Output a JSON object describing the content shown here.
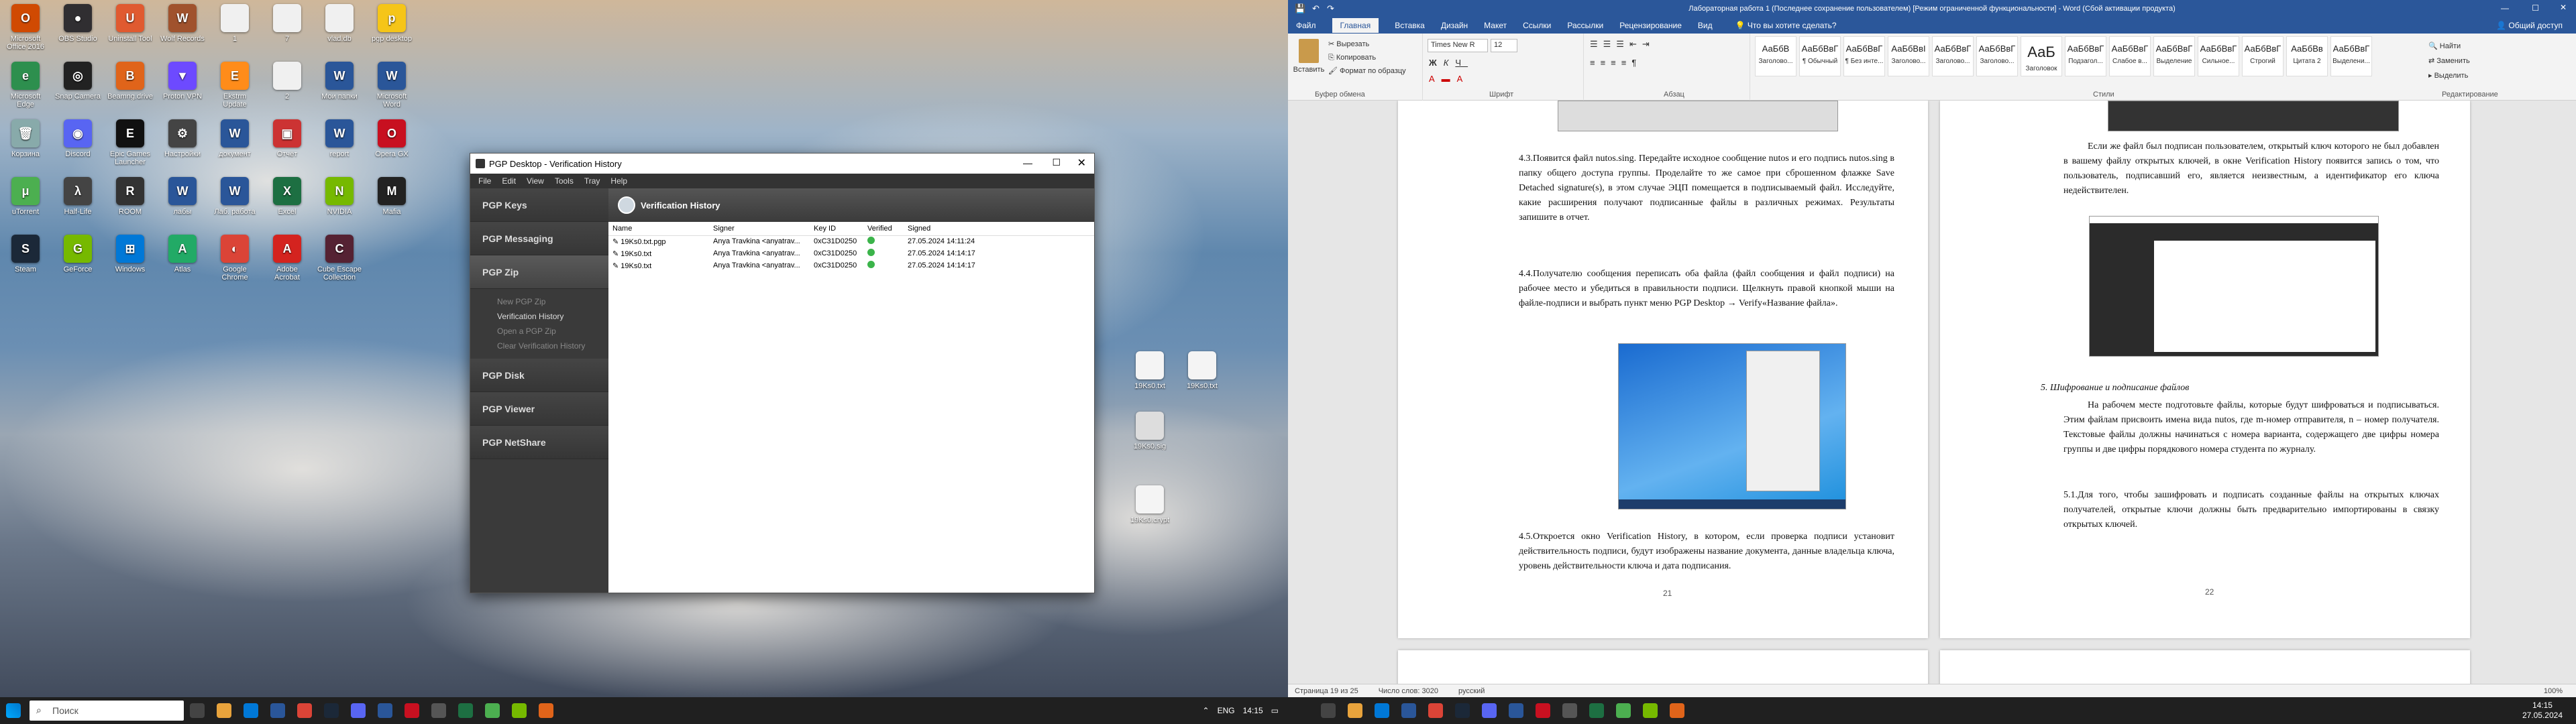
{
  "desktop": {
    "icons": [
      {
        "label": "Microsoft Office 2016",
        "color": "#d04a02",
        "g": "O"
      },
      {
        "label": "OBS Studio",
        "color": "#302e31",
        "g": "●"
      },
      {
        "label": "Uninstall Tool",
        "color": "#e05a30",
        "g": "U"
      },
      {
        "label": "Wolf Records",
        "color": "#a0522d",
        "g": "W"
      },
      {
        "label": "1",
        "color": "#f0f0f0",
        "g": ""
      },
      {
        "label": "7",
        "color": "#f0f0f0",
        "g": ""
      },
      {
        "label": "vlad.db",
        "color": "#f0f0f0",
        "g": ""
      },
      {
        "label": "pgp desktop",
        "color": "#f5c518",
        "g": "p"
      },
      {
        "label": "Microsoft Edge",
        "color": "#2d8f4e",
        "g": "e"
      },
      {
        "label": "Snap Camera",
        "color": "#222",
        "g": "◎"
      },
      {
        "label": "Beamng.drive",
        "color": "#e0641a",
        "g": "B"
      },
      {
        "label": "Proton VPN",
        "color": "#6d4aff",
        "g": "▼"
      },
      {
        "label": "Ekstrm Update",
        "color": "#ff8c1a",
        "g": "E"
      },
      {
        "label": "2",
        "color": "#f0f0f0",
        "g": ""
      },
      {
        "label": "Мои папки",
        "color": "#2a5699",
        "g": "W"
      },
      {
        "label": "Microsoft Word",
        "color": "#2a5699",
        "g": "W"
      },
      {
        "label": "Корзина",
        "color": "#8aa",
        "g": "🗑"
      },
      {
        "label": "Discord",
        "color": "#5865f2",
        "g": "◉"
      },
      {
        "label": "Epic Games Launcher",
        "color": "#111",
        "g": "E"
      },
      {
        "label": "Настройки",
        "color": "#444",
        "g": "⚙"
      },
      {
        "label": "документ",
        "color": "#2a5699",
        "g": "W"
      },
      {
        "label": "Отчёт",
        "color": "#c33",
        "g": "▣"
      },
      {
        "label": "report",
        "color": "#2a5699",
        "g": "W"
      },
      {
        "label": "Opera GX",
        "color": "#c81020",
        "g": "O"
      },
      {
        "label": "uTorrent",
        "color": "#4caf50",
        "g": "μ"
      },
      {
        "label": "Half-Life",
        "color": "#444",
        "g": "λ"
      },
      {
        "label": "ROOM",
        "color": "#333",
        "g": "R"
      },
      {
        "label": "лабы",
        "color": "#2a5699",
        "g": "W"
      },
      {
        "label": "Лаб. работа",
        "color": "#2a5699",
        "g": "W"
      },
      {
        "label": "Excel",
        "color": "#1d6f42",
        "g": "X"
      },
      {
        "label": "NVIDIA",
        "color": "#76b900",
        "g": "N"
      },
      {
        "label": "Mafia",
        "color": "#222",
        "g": "M"
      },
      {
        "label": "Steam",
        "color": "#1b2838",
        "g": "S"
      },
      {
        "label": "GeForce",
        "color": "#76b900",
        "g": "G"
      },
      {
        "label": "Windows",
        "color": "#0078d7",
        "g": "⊞"
      },
      {
        "label": "Atlas",
        "color": "#2a6",
        "g": "A"
      },
      {
        "label": "Google Chrome",
        "color": "#db4437",
        "g": "◐"
      },
      {
        "label": "Adobe Acrobat",
        "color": "#d4231f",
        "g": "A"
      },
      {
        "label": "Cube Escape Collection",
        "color": "#552233",
        "g": "C"
      }
    ],
    "files_right": [
      {
        "label": "19Ks0.txt"
      },
      {
        "label": "19Ks0.txt"
      },
      {
        "label": "19Ks0.sig"
      },
      {
        "label": "19Ks0.crypt"
      }
    ]
  },
  "pgp": {
    "title": "PGP Desktop - Verification History",
    "menu": [
      "File",
      "Edit",
      "View",
      "Tools",
      "Tray",
      "Help"
    ],
    "sections": [
      {
        "label": "PGP Keys"
      },
      {
        "label": "PGP Messaging"
      },
      {
        "label": "PGP Zip"
      },
      {
        "label": "PGP Disk"
      },
      {
        "label": "PGP Viewer"
      },
      {
        "label": "PGP NetShare"
      }
    ],
    "zip_items": [
      {
        "label": "New PGP Zip",
        "dim": true
      },
      {
        "label": "Verification History",
        "dim": false
      },
      {
        "label": "Open a PGP Zip",
        "dim": true
      },
      {
        "label": "Clear Verification History",
        "dim": true
      }
    ],
    "panel_title": "Verification History",
    "columns": [
      "Name",
      "Signer",
      "Key ID",
      "Verified",
      "Signed"
    ],
    "rows": [
      {
        "name": "19Ks0.txt.pgp",
        "signer": "Anya Travkina <anyatrav...",
        "key": "0xC31D0250",
        "signed": "27.05.2024 14:11:24"
      },
      {
        "name": "19Ks0.txt",
        "signer": "Anya Travkina <anyatrav...",
        "key": "0xC31D0250",
        "signed": "27.05.2024 14:14:17"
      },
      {
        "name": "19Ks0.txt",
        "signer": "Anya Travkina <anyatrav...",
        "key": "0xC31D0250",
        "signed": "27.05.2024 14:14:17"
      }
    ]
  },
  "taskbar_left": {
    "search_placeholder": "Поиск",
    "time": "14:15",
    "lang": "ENG"
  },
  "word": {
    "title": "Лабораторная работа 1 (Последнее сохранение пользователем) [Режим ограниченной функциональности] - Word (Сбой активации продукта)",
    "tabs": [
      "Файл",
      "Главная",
      "Вставка",
      "Дизайн",
      "Макет",
      "Ссылки",
      "Рассылки",
      "Рецензирование",
      "Вид"
    ],
    "tell_me": "Что вы хотите сделать?",
    "share": "Общий доступ",
    "clipboard": {
      "paste": "Вставить",
      "cut": "Вырезать",
      "copy": "Копировать",
      "format": "Формат по образцу",
      "label": "Буфер обмена"
    },
    "font": {
      "name": "Times New R",
      "size": "12",
      "label": "Шрифт"
    },
    "paragraph_label": "Абзац",
    "styles_label": "Стили",
    "editing": {
      "find": "Найти",
      "replace": "Заменить",
      "select": "Выделить",
      "label": "Редактирование"
    },
    "styles": [
      {
        "sample": "АаБбВ",
        "name": "Заголово..."
      },
      {
        "sample": "АаБбВвГ",
        "name": "¶ Обычный"
      },
      {
        "sample": "АаБбВвГ",
        "name": "¶ Без инте..."
      },
      {
        "sample": "АаБбВвI",
        "name": "Заголово..."
      },
      {
        "sample": "АаБбВвГ",
        "name": "Заголово..."
      },
      {
        "sample": "АаБбВвГ",
        "name": "Заголово..."
      },
      {
        "sample": "АаБ",
        "name": "Заголовок"
      },
      {
        "sample": "АаБбВвГ",
        "name": "Подзагол..."
      },
      {
        "sample": "АаБбВвГ",
        "name": "Слабое в..."
      },
      {
        "sample": "АаБбВвГ",
        "name": "Выделение"
      },
      {
        "sample": "АаБбВвГ",
        "name": "Сильное..."
      },
      {
        "sample": "АаБбВвГ",
        "name": "Строгий"
      },
      {
        "sample": "АаБбВв",
        "name": "Цитата 2"
      },
      {
        "sample": "АаБбВвГ",
        "name": "Выделени..."
      }
    ],
    "page_left": {
      "p43": "4.3.Появится файл nutos.sing. Передайте исходное сообщение nutos и его подпись nutos.sing в папку общего доступа группы. Проделайте то же самое при сброшенном флажке Save Detached signature(s), в этом случае ЭЦП помещается в подписываемый файл. Исследуйте, какие расширения получают подписанные файлы в различных режимах. Результаты запишите в отчет.",
      "p44": "4.4.Получателю сообщения переписать оба файла (файл сообщения и файл подписи) на рабочее место и убедиться в правильности подписи. Щелкнуть правой кнопкой мыши на файле-подписи и выбрать пункт меню PGP Desktop → Verify«Название файла».",
      "p45": "4.5.Откроется окно Verification History, в котором, если проверка подписи установит действительность подписи, будут изображены название документа, данные владельца ключа, уровень действительности ключа и дата подписания.",
      "page_num": "21"
    },
    "page_right": {
      "p1": "Если же файл был подписан пользователем, открытый ключ которого не был добавлен в вашему файлу открытых ключей, в окне Verification History появится запись о том, что пользователь, подписавший его, является неизвестным, а идентификатор его ключа недействителен.",
      "h5": "5.   Шифрование и подписание файлов",
      "p2": "На рабочем месте подготовьте файлы, которые будут шифроваться и подписываться. Этим файлам присвоить имена вида nutos, где m-номер отправителя, n – номер получателя. Текстовые файлы должны начинаться с номера варианта, содержащего две цифры номера группы и две цифры порядкового номера студента по журналу.",
      "p51": "5.1.Для того, чтобы зашифровать и подписать созданные файлы на открытых ключах получателей, открытые ключи должны быть предварительно импортированы в связку открытых ключей.",
      "page_num": "22"
    },
    "status": {
      "page": "Страница 19 из 25",
      "words": "Число слов: 3020",
      "lang": "русский",
      "zoom": "100%"
    }
  },
  "taskbar_right": {
    "time": "14:15",
    "date": "27.05.2024"
  }
}
